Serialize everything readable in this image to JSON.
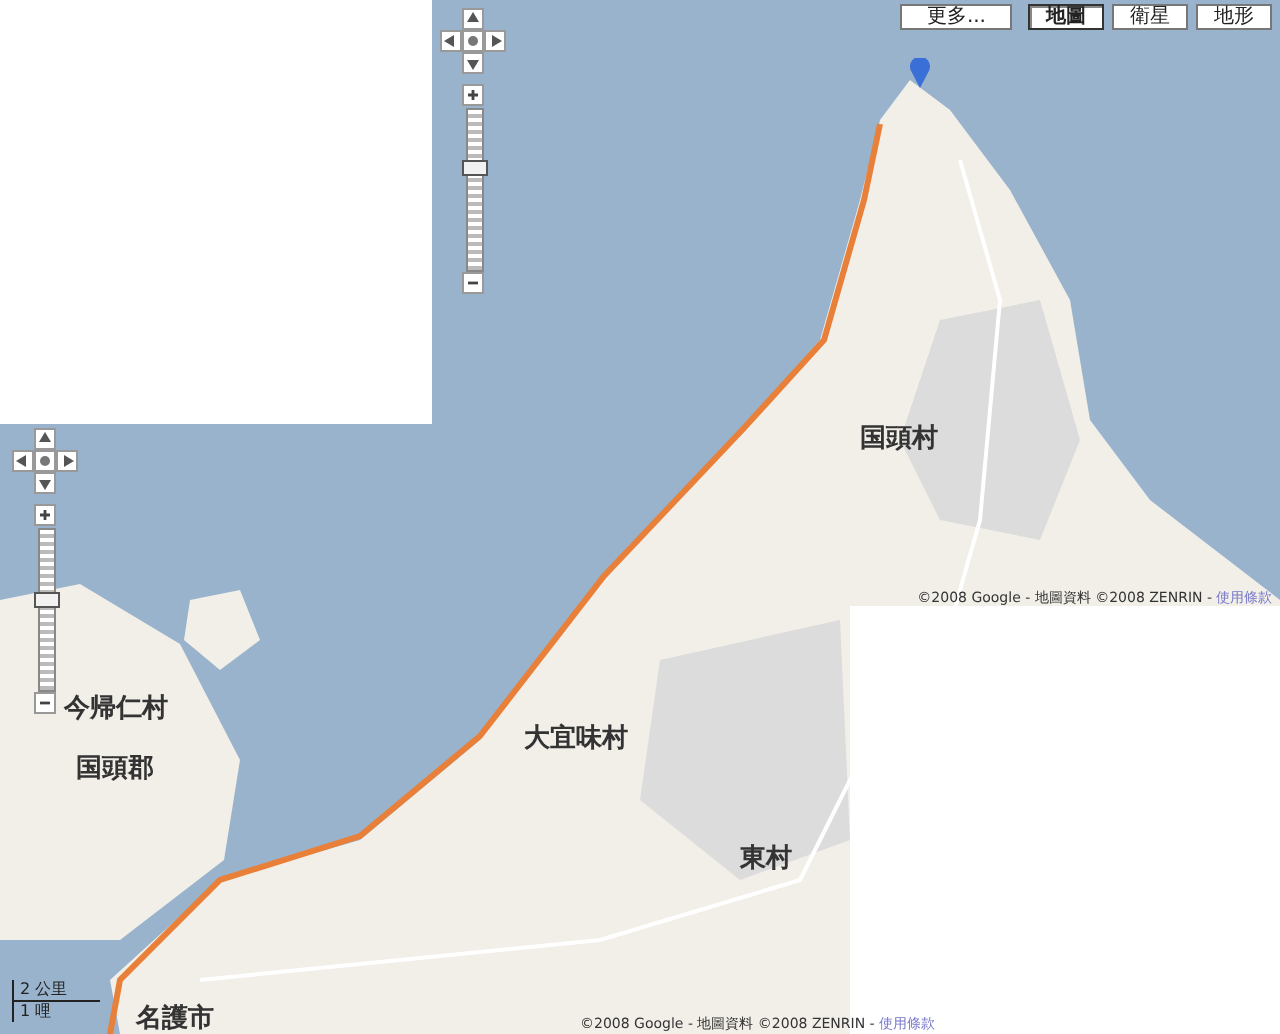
{
  "map_type_buttons": [
    {
      "label": "更多...",
      "selected": false
    },
    {
      "label": "地圖",
      "selected": true
    },
    {
      "label": "衛星",
      "selected": false
    },
    {
      "label": "地形",
      "selected": false
    }
  ],
  "zoom_controls": [
    {
      "level": 0.65
    },
    {
      "level": 0.57
    }
  ],
  "place_labels": [
    "国頭村",
    "今帰仁村",
    "大宜味村",
    "国頭郡",
    "東村",
    "名護市"
  ],
  "copyrights": [
    {
      "text": "©2008 Google - 地圖資料 ©2008 ZENRIN -",
      "link": "使用條款"
    },
    {
      "text": "©2008 Google - 地圖資料 ©2008 ZENRIN -",
      "link": "使用條款"
    }
  ],
  "scale": {
    "metric": "2 公里",
    "imperial": "1 哩"
  }
}
